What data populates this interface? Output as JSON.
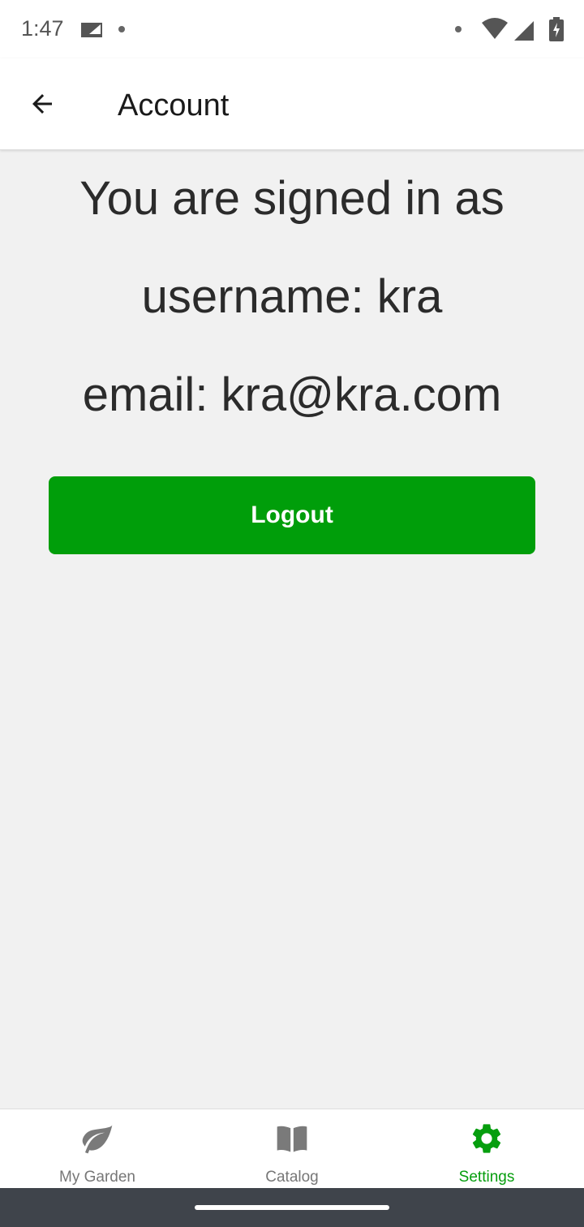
{
  "status_bar": {
    "time": "1:47"
  },
  "app_bar": {
    "title": "Account"
  },
  "account": {
    "signed_in_text": "You are signed in as",
    "username_text": "username: kra",
    "email_text": "email: kra@kra.com",
    "logout_label": "Logout"
  },
  "bottom_nav": {
    "items": [
      {
        "label": "My Garden",
        "icon": "leaf-icon",
        "active": false
      },
      {
        "label": "Catalog",
        "icon": "book-icon",
        "active": false
      },
      {
        "label": "Settings",
        "icon": "gear-icon",
        "active": true
      }
    ]
  },
  "colors": {
    "accent": "#009e0a",
    "inactive": "#777777",
    "background": "#f1f1f1"
  }
}
